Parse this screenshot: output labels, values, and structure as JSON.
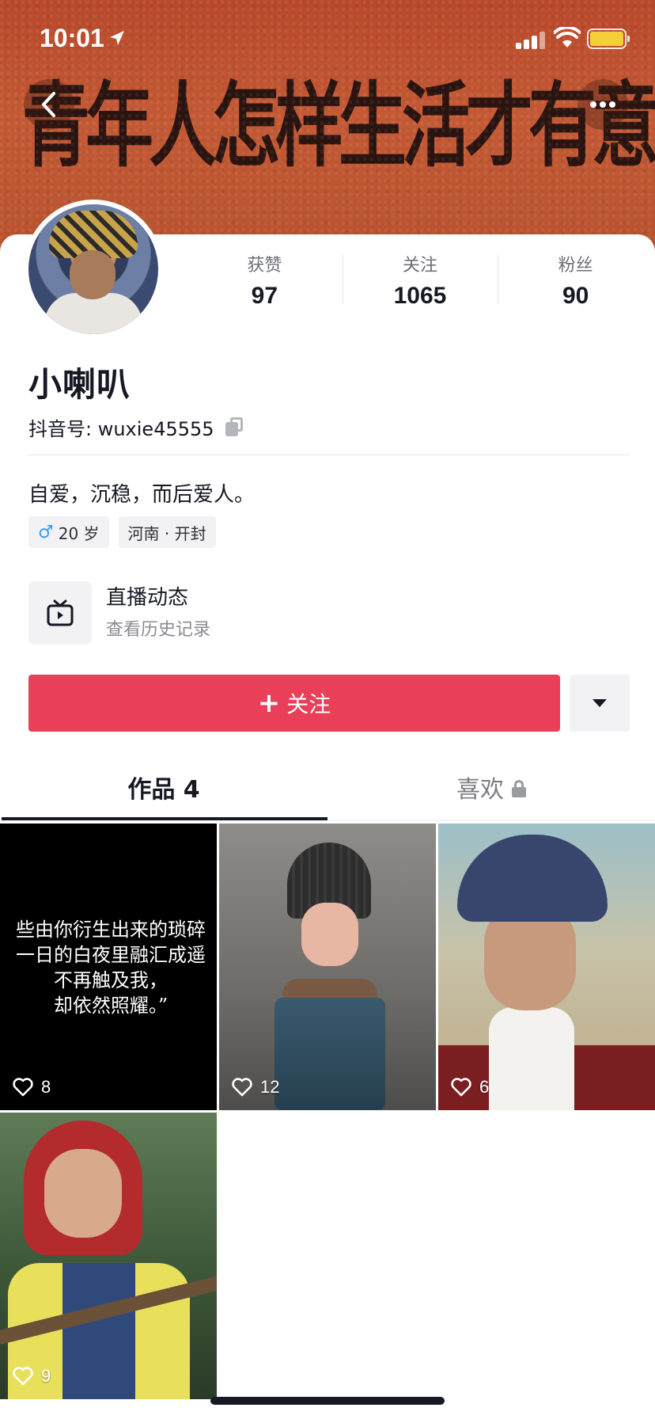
{
  "status_bar": {
    "time": "10:01"
  },
  "cover": {
    "slogan": "青年人怎样生活才有意思"
  },
  "nav": {
    "back_icon": "chevron-left-icon",
    "more_icon": "more-dots-icon"
  },
  "profile": {
    "stats": [
      {
        "label": "获赞",
        "value": "97"
      },
      {
        "label": "关注",
        "value": "1065"
      },
      {
        "label": "粉丝",
        "value": "90"
      }
    ],
    "nickname": "小喇叭",
    "douyin_id": "抖音号: wuxie45555",
    "bio": "自爱，沉稳，而后爱人。",
    "tags": [
      {
        "icon": "male-icon",
        "symbol": "♂",
        "label": "20 岁"
      },
      {
        "label": "河南 · 开封"
      }
    ],
    "live": {
      "title": "直播动态",
      "subtitle": "查看历史记录"
    },
    "follow_label": "关注",
    "follow_plus": "+"
  },
  "tabs": [
    {
      "label": "作品 4",
      "active": true
    },
    {
      "label": "喜欢",
      "active": false,
      "locked": true
    }
  ],
  "videos": [
    {
      "likes": "8",
      "poem_lines": [
        "些由你衍生出来的琐碎",
        "一日的白夜里融汇成遥",
        "不再触及我，",
        "却依然照耀。”"
      ]
    },
    {
      "likes": "12"
    },
    {
      "likes": "6"
    },
    {
      "likes": "9"
    }
  ],
  "colors": {
    "accent": "#ea3f58",
    "cover": "#b8482b",
    "text": "#161823",
    "male": "#3a9bf3"
  }
}
